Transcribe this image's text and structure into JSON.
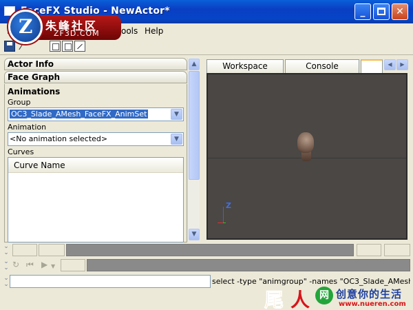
{
  "window": {
    "title": "FaceFX Studio - NewActor*",
    "minimize_icon": "minimize-icon",
    "maximize_icon": "maximize-icon",
    "close_icon": "close-icon"
  },
  "watermark_logo": {
    "letter": "Z",
    "cn_text": "朱峰社区",
    "en_text": "ZF3D.COM"
  },
  "menubar": {
    "items": [
      {
        "label": "F"
      },
      {
        "label": "ools"
      },
      {
        "label": "Help"
      }
    ]
  },
  "toolbar": {
    "icons": [
      "save-icon",
      "magic-wand-icon",
      "layout-icon-1",
      "layout-icon-2",
      "edit-icon"
    ]
  },
  "left_panel": {
    "actor_info": "Actor Info",
    "face_graph": "Face Graph",
    "animations": {
      "title": "Animations",
      "group_label": "Group",
      "group_value": "OC3_Slade_AMesh_FaceFX_AnimSet",
      "animation_label": "Animation",
      "animation_value": "<No animation selected>",
      "curves_label": "Curves",
      "curve_column": "Curve Name"
    }
  },
  "right_panel": {
    "tabs": [
      {
        "label": "Workspace"
      },
      {
        "label": "Console"
      }
    ],
    "viewport": {
      "axis_label": "Z"
    }
  },
  "command_bar": {
    "input_value": "",
    "output_text": "select -type \"animgroup\" -names \"OC3_Slade_AMesh"
  },
  "bottom_logo": {
    "big1": "尾",
    "big2": "人",
    "circle": "网",
    "slogan": "创意你的生活",
    "url": "www.nueren.com"
  },
  "colors": {
    "titlebar_blue": "#0a3ec3",
    "viewport_bg": "#4a4745",
    "selection_blue": "#316ac5"
  }
}
